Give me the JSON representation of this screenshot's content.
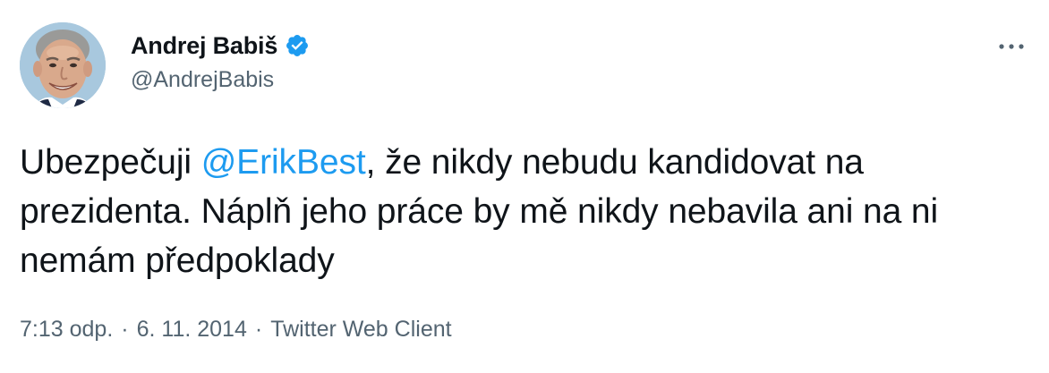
{
  "author": {
    "display_name": "Andrej Babiš",
    "handle": "@AndrejBabis",
    "verified": true,
    "avatar_icon": "profile-photo"
  },
  "tweet": {
    "text_before": "Ubezpečuji ",
    "mention": "@ErikBest",
    "text_after": ", že nikdy nebudu kandidovat na prezidenta. Náplň jeho práce by mě nikdy nebavila ani na ni nemám předpoklady"
  },
  "meta": {
    "time": "7:13 odp.",
    "separator": "·",
    "date": "6. 11. 2014",
    "client": "Twitter Web Client"
  },
  "menu": {
    "icon": "more-horizontal-icon"
  },
  "colors": {
    "link": "#1d9bf0",
    "secondary_text": "#536471",
    "primary_text": "#0f1419",
    "verified_badge": "#1d9bf0"
  }
}
